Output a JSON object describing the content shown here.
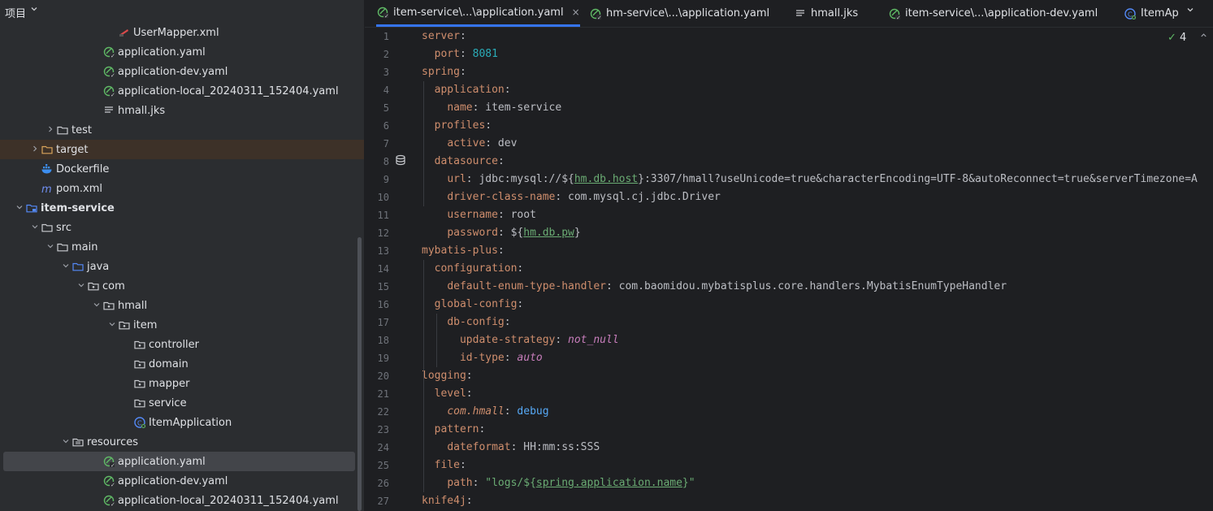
{
  "project_panel": {
    "title": "项目",
    "tree": [
      {
        "depth": 7,
        "label": "UserMapper.xml",
        "icon": "xml-icon",
        "arrow": ""
      },
      {
        "depth": 6,
        "label": "application.yaml",
        "icon": "spring-yaml-icon",
        "arrow": ""
      },
      {
        "depth": 6,
        "label": "application-dev.yaml",
        "icon": "spring-yaml-icon",
        "arrow": ""
      },
      {
        "depth": 6,
        "label": "application-local_20240311_152404.yaml",
        "icon": "spring-yaml-icon",
        "arrow": ""
      },
      {
        "depth": 6,
        "label": "hmall.jks",
        "icon": "file-lines-icon",
        "arrow": ""
      },
      {
        "depth": 3,
        "label": "test",
        "icon": "folder-icon",
        "arrow": "right"
      },
      {
        "depth": 2,
        "label": "target",
        "icon": "folder-orange-icon",
        "arrow": "right",
        "highlight": true
      },
      {
        "depth": 2,
        "label": "Dockerfile",
        "icon": "docker-icon",
        "arrow": ""
      },
      {
        "depth": 2,
        "label": "pom.xml",
        "icon": "maven-icon",
        "arrow": ""
      },
      {
        "depth": 1,
        "label": "item-service",
        "icon": "module-icon",
        "arrow": "down",
        "bold": true
      },
      {
        "depth": 2,
        "label": "src",
        "icon": "folder-icon",
        "arrow": "down"
      },
      {
        "depth": 3,
        "label": "main",
        "icon": "folder-icon",
        "arrow": "down"
      },
      {
        "depth": 4,
        "label": "java",
        "icon": "folder-blue-icon",
        "arrow": "down"
      },
      {
        "depth": 5,
        "label": "com",
        "icon": "package-icon",
        "arrow": "down"
      },
      {
        "depth": 6,
        "label": "hmall",
        "icon": "package-icon",
        "arrow": "down"
      },
      {
        "depth": 7,
        "label": "item",
        "icon": "package-icon",
        "arrow": "down"
      },
      {
        "depth": 8,
        "label": "controller",
        "icon": "package-icon",
        "arrow": ""
      },
      {
        "depth": 8,
        "label": "domain",
        "icon": "package-icon",
        "arrow": ""
      },
      {
        "depth": 8,
        "label": "mapper",
        "icon": "package-icon",
        "arrow": ""
      },
      {
        "depth": 8,
        "label": "service",
        "icon": "package-icon",
        "arrow": ""
      },
      {
        "depth": 8,
        "label": "ItemApplication",
        "icon": "spring-class-icon",
        "arrow": ""
      },
      {
        "depth": 4,
        "label": "resources",
        "icon": "resources-folder-icon",
        "arrow": "down"
      },
      {
        "depth": 6,
        "label": "application.yaml",
        "icon": "spring-yaml-icon",
        "arrow": "",
        "selected": true
      },
      {
        "depth": 6,
        "label": "application-dev.yaml",
        "icon": "spring-yaml-icon",
        "arrow": ""
      },
      {
        "depth": 6,
        "label": "application-local_20240311_152404.yaml",
        "icon": "spring-yaml-icon",
        "arrow": ""
      }
    ]
  },
  "tabs": [
    {
      "label": "item-service\\...\\application.yaml",
      "icon": "spring-yaml-icon",
      "active": true,
      "close": "×"
    },
    {
      "label": "hm-service\\...\\application.yaml",
      "icon": "spring-yaml-icon",
      "active": false
    },
    {
      "label": "hmall.jks",
      "icon": "file-lines-icon",
      "active": false
    },
    {
      "label": "item-service\\...\\application-dev.yaml",
      "icon": "spring-yaml-icon",
      "active": false
    },
    {
      "label": "ItemAp",
      "icon": "spring-class-icon",
      "active": false
    }
  ],
  "inspections": {
    "count": "4"
  },
  "code_lines": [
    [
      [
        "k",
        "server"
      ],
      [
        "v",
        ":"
      ]
    ],
    [
      [
        "v",
        "  "
      ],
      [
        "k",
        "port"
      ],
      [
        "v",
        ": "
      ],
      [
        "n",
        "8081"
      ]
    ],
    [
      [
        "k",
        "spring"
      ],
      [
        "v",
        ":"
      ]
    ],
    [
      [
        "v",
        "  "
      ],
      [
        "k",
        "application"
      ],
      [
        "v",
        ":"
      ]
    ],
    [
      [
        "v",
        "    "
      ],
      [
        "k",
        "name"
      ],
      [
        "v",
        ": item-service"
      ]
    ],
    [
      [
        "v",
        "  "
      ],
      [
        "k",
        "profiles"
      ],
      [
        "v",
        ":"
      ]
    ],
    [
      [
        "v",
        "    "
      ],
      [
        "k",
        "active"
      ],
      [
        "v",
        ": dev"
      ]
    ],
    [
      [
        "v",
        "  "
      ],
      [
        "k",
        "datasource"
      ],
      [
        "v",
        ":"
      ]
    ],
    [
      [
        "v",
        "    "
      ],
      [
        "k",
        "url"
      ],
      [
        "v",
        ": jdbc:mysql://${"
      ],
      [
        "u",
        "hm.db.host"
      ],
      [
        "v",
        "}:3307/hmall?useUnicode=true&characterEncoding=UTF-8&autoReconnect=true&serverTimezone=A"
      ]
    ],
    [
      [
        "v",
        "    "
      ],
      [
        "k",
        "driver-class-name"
      ],
      [
        "v",
        ": com.mysql.cj.jdbc.Driver"
      ]
    ],
    [
      [
        "v",
        "    "
      ],
      [
        "k",
        "username"
      ],
      [
        "v",
        ": root"
      ]
    ],
    [
      [
        "v",
        "    "
      ],
      [
        "k",
        "password"
      ],
      [
        "v",
        ": ${"
      ],
      [
        "u",
        "hm.db.pw"
      ],
      [
        "v",
        "}"
      ]
    ],
    [
      [
        "k",
        "mybatis-plus"
      ],
      [
        "v",
        ":"
      ]
    ],
    [
      [
        "v",
        "  "
      ],
      [
        "k",
        "configuration"
      ],
      [
        "v",
        ":"
      ]
    ],
    [
      [
        "v",
        "    "
      ],
      [
        "k",
        "default-enum-type-handler"
      ],
      [
        "v",
        ": com.baomidou.mybatisplus.core.handlers.MybatisEnumTypeHandler"
      ]
    ],
    [
      [
        "v",
        "  "
      ],
      [
        "k",
        "global-config"
      ],
      [
        "v",
        ":"
      ]
    ],
    [
      [
        "v",
        "    "
      ],
      [
        "k",
        "db-config"
      ],
      [
        "v",
        ":"
      ]
    ],
    [
      [
        "v",
        "      "
      ],
      [
        "k",
        "update-strategy"
      ],
      [
        "v",
        ": "
      ],
      [
        "it",
        "not_null"
      ]
    ],
    [
      [
        "v",
        "      "
      ],
      [
        "k",
        "id-type"
      ],
      [
        "v",
        ": "
      ],
      [
        "it",
        "auto"
      ]
    ],
    [
      [
        "k",
        "logging"
      ],
      [
        "v",
        ":"
      ]
    ],
    [
      [
        "v",
        "  "
      ],
      [
        "k",
        "level"
      ],
      [
        "v",
        ":"
      ]
    ],
    [
      [
        "v",
        "    "
      ],
      [
        "ik",
        "com.hmall"
      ],
      [
        "v",
        ": "
      ],
      [
        "kw",
        "debug"
      ]
    ],
    [
      [
        "v",
        "  "
      ],
      [
        "k",
        "pattern"
      ],
      [
        "v",
        ":"
      ]
    ],
    [
      [
        "v",
        "    "
      ],
      [
        "k",
        "dateformat"
      ],
      [
        "v",
        ": HH:mm:ss:SSS"
      ]
    ],
    [
      [
        "v",
        "  "
      ],
      [
        "k",
        "file"
      ],
      [
        "v",
        ":"
      ]
    ],
    [
      [
        "v",
        "    "
      ],
      [
        "k",
        "path"
      ],
      [
        "v",
        ": "
      ],
      [
        "s",
        "\"logs/${"
      ],
      [
        "u",
        "spring.application.name"
      ],
      [
        "s",
        "}\""
      ]
    ],
    [
      [
        "k",
        "knife4j"
      ],
      [
        "v",
        ":"
      ]
    ]
  ]
}
